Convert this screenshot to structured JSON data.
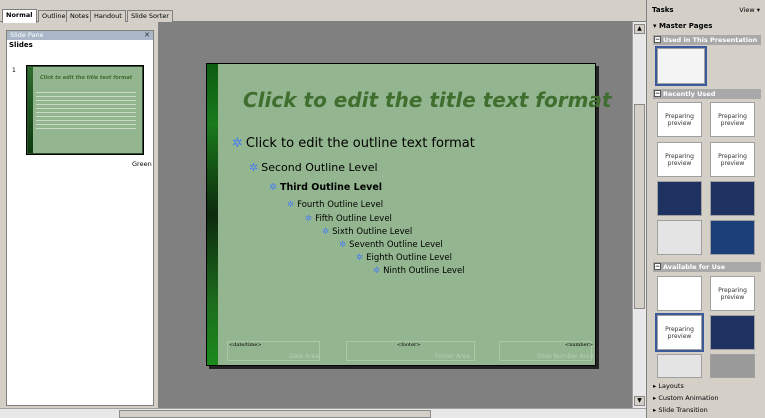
{
  "tabs": [
    "Normal",
    "Outline",
    "Notes",
    "Handout",
    "Slide Sorter"
  ],
  "slide_pane": {
    "title": "Slide Pane",
    "heading": "Slides",
    "number": "1",
    "thumb_title": "Click to edit the title text format",
    "label": "Green"
  },
  "slide": {
    "title": "Click to edit the title text format",
    "levels": [
      "Click to edit the outline text format",
      "Second Outline Level",
      "Third Outline Level",
      "Fourth Outline Level",
      "Fifth Outline Level",
      "Sixth Outline Level",
      "Seventh Outline Level",
      "Eighth Outline Level",
      "Ninth Outline Level"
    ],
    "footer": {
      "datetime": "<date/time>",
      "datetime_hint": "Date Area",
      "footer": "<footer>",
      "footer_hint": "Footer Area",
      "number": "<number>",
      "number_hint": "Slide Number Area"
    }
  },
  "tasks": {
    "title": "Tasks",
    "view": "View",
    "master_pages": "Master Pages",
    "used_in_presentation": "Used in This Presentation",
    "recently_used": "Recently Used",
    "available_for_use": "Available for Use",
    "preparing_preview": "Preparing preview",
    "layouts": "Layouts",
    "custom_animation": "Custom Animation",
    "slide_transition": "Slide Transition"
  },
  "colors": {
    "slide_background": "#93b58f",
    "title_text": "#3f6e2f",
    "bullet": "#4a7ff2"
  }
}
